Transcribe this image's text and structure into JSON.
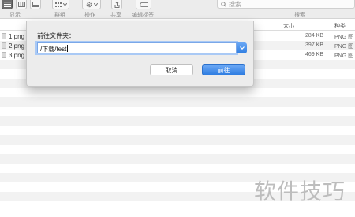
{
  "toolbar": {
    "labels": {
      "view": "显示",
      "group": "群组",
      "action": "操作",
      "share": "共享",
      "edit_tags": "编辑标签",
      "search": "搜索"
    },
    "search_placeholder": "搜索"
  },
  "list": {
    "columns": {
      "size": "大小",
      "kind": "种类"
    },
    "files": [
      {
        "name": "1.png",
        "size": "284 KB",
        "kind": "PNG 图"
      },
      {
        "name": "2.png",
        "size": "397 KB",
        "kind": "PNG 图"
      },
      {
        "name": "3.png",
        "size": "469 KB",
        "kind": "PNG 图"
      }
    ]
  },
  "dialog": {
    "title": "前往文件夹：",
    "path_value": "/下载/test",
    "cancel_label": "取消",
    "go_label": "前往"
  },
  "watermark": "软件技巧"
}
